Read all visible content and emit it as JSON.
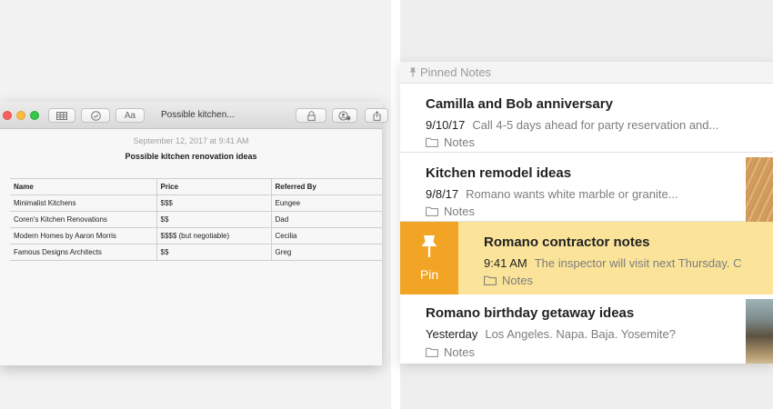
{
  "left": {
    "window_title": "Possible kitchen...",
    "toolbar": {
      "table_button": "table-icon",
      "checklist_button": "checkmark-icon",
      "format_label": "Aa",
      "lock_button": "lock-icon",
      "share_people_button": "add-people-icon",
      "share_button": "share-icon"
    },
    "note_date": "September 12, 2017 at 9:41 AM",
    "note_heading": "Possible kitchen renovation ideas",
    "table": {
      "headers": [
        "Name",
        "Price",
        "Referred By"
      ],
      "rows": [
        [
          "Minimalist Kitchens",
          "$$$",
          "Eungee"
        ],
        [
          "Coren's Kitchen Renovations",
          "$$",
          "Dad"
        ],
        [
          "Modern Homes by Aaron Morris",
          "$$$$ (but negotiable)",
          "Cecilia"
        ],
        [
          "Famous Designs Architects",
          "$$",
          "Greg"
        ]
      ]
    }
  },
  "right": {
    "section_label": "Pinned Notes",
    "pin_action_label": "Pin",
    "notes": [
      {
        "title": "Camilla and Bob anniversary",
        "date": "9/10/17",
        "preview": "Call 4-5 days ahead for party reservation and...",
        "folder": "Notes"
      },
      {
        "title": "Kitchen remodel ideas",
        "date": "9/8/17",
        "preview": "Romano wants white marble or granite...",
        "folder": "Notes"
      },
      {
        "title": "Romano contractor notes",
        "date": "9:41 AM",
        "preview": "The inspector will visit next Thursday. C",
        "folder": "Notes"
      },
      {
        "title": "Romano birthday getaway ideas",
        "date": "Yesterday",
        "preview": "Los Angeles. Napa. Baja. Yosemite?",
        "folder": "Notes"
      }
    ]
  },
  "colors": {
    "pin_orange": "#f2a424",
    "highlight_yellow": "#fbe49a",
    "traffic_red": "#fc605c",
    "traffic_yellow": "#fdbc40",
    "traffic_green": "#34c84a"
  }
}
